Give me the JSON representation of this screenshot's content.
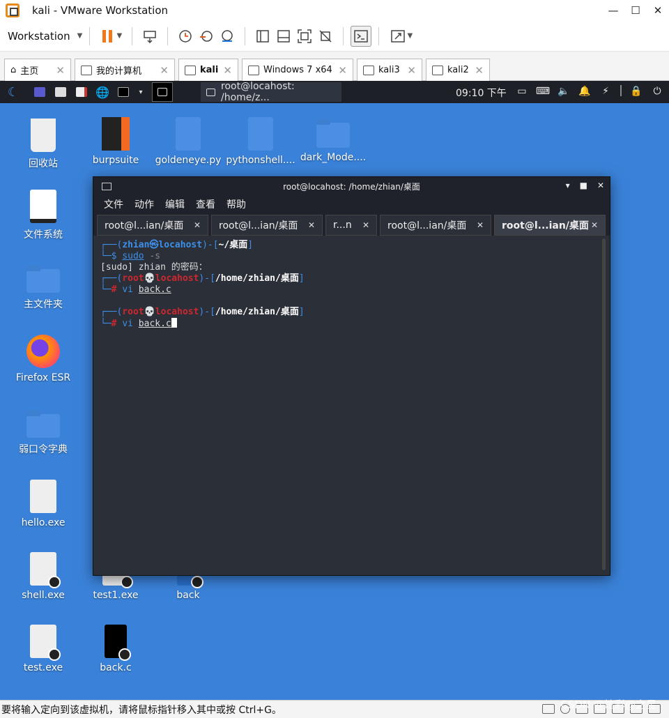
{
  "window": {
    "title": "kali - VMware Workstation",
    "ctrl_min": "—",
    "ctrl_max": "☐",
    "ctrl_close": "✕"
  },
  "toolbar": {
    "workstation_label": "Workstation"
  },
  "vm_tabs": [
    {
      "label": "主页"
    },
    {
      "label": "我的计算机"
    },
    {
      "label": "kali"
    },
    {
      "label": "Windows 7 x64"
    },
    {
      "label": "kali3"
    },
    {
      "label": "kali2"
    }
  ],
  "kali_panel": {
    "task_label": "root@locahost: /home/z...",
    "clock": "09:10 下午"
  },
  "desktop_icons": [
    {
      "label": "回收站"
    },
    {
      "label": "burpsuite"
    },
    {
      "label": "goldeneye.py"
    },
    {
      "label": "pythonshell...."
    },
    {
      "label": "dark_Mode...."
    },
    {
      "label": "文件系统"
    },
    {
      "label": "主文件夹"
    },
    {
      "label": "Firefox ESR"
    },
    {
      "label": "弱口令字典"
    },
    {
      "label": "hello.exe"
    },
    {
      "label": "shell.exe"
    },
    {
      "label": "test1.exe"
    },
    {
      "label": "back"
    },
    {
      "label": "test.exe"
    },
    {
      "label": "back.c"
    }
  ],
  "terminal": {
    "title": "root@locahost: /home/zhian/桌面",
    "menu": [
      "文件",
      "动作",
      "编辑",
      "查看",
      "帮助"
    ],
    "tabs": [
      {
        "label": "root@l...ian/桌面"
      },
      {
        "label": "root@l...ian/桌面"
      },
      {
        "label": "r...n"
      },
      {
        "label": "root@l...ian/桌面"
      },
      {
        "label": "root@l...ian/桌面"
      }
    ],
    "lines": {
      "l1_user": "zhian㉿locahost",
      "l1_path": "~/桌面",
      "l2_cmd": "sudo",
      "l2_arg": "-s",
      "l3": "[sudo] zhian 的密码：",
      "l4_user": "root💀locahost",
      "l4_path": "/home/zhian/桌面",
      "l5_cmd": "vi",
      "l5_arg": "back.c",
      "l6_user": "root💀locahost",
      "l6_path": "/home/zhian/桌面",
      "l7_cmd": "vi",
      "l7_arg": "back.c"
    }
  },
  "status_bar": {
    "message": "要将输入定向到该虚拟机，请将鼠标指针移入其中或按 Ctrl+G。"
  },
  "watermark": "CSDN @炫彩@之星"
}
